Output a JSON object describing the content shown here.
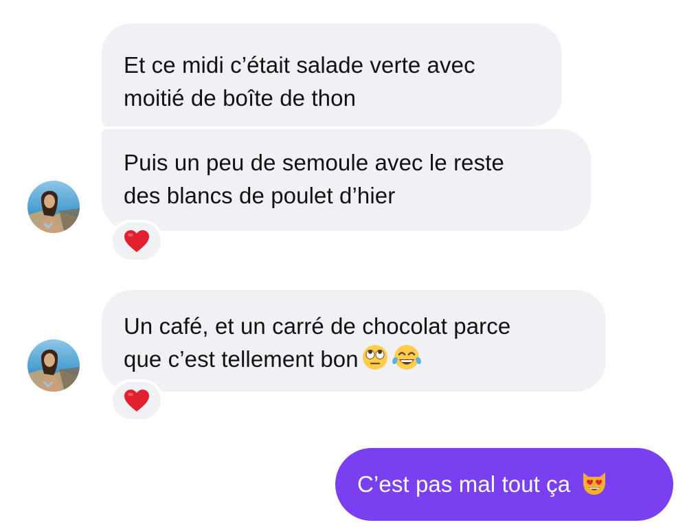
{
  "messages": [
    {
      "id": "b1",
      "sender": "other",
      "text": "Et ce midi c’était salade verte avec\nmoitié de boîte de thon"
    },
    {
      "id": "b2",
      "sender": "other",
      "text": "Puis un peu de semoule avec le reste\ndes blancs de poulet d’hier",
      "reaction": "red-heart"
    },
    {
      "id": "b3",
      "sender": "other",
      "text": "Un café, et un carré de chocolat parce\nque c’est tellement bon",
      "trailing_emojis": [
        "face-with-rolling-eyes",
        "face-with-tears-of-joy"
      ],
      "reaction": "red-heart"
    },
    {
      "id": "b4",
      "sender": "me",
      "text": "C’est pas mal tout ça",
      "trailing_emojis": [
        "smiling-cat-with-heart-eyes"
      ]
    }
  ],
  "colors": {
    "incoming_bubble": "#eff1f4",
    "outgoing_bubble": "#7a3ff0",
    "outgoing_text": "#ffffff",
    "heart": "#e0202e"
  },
  "icons": {
    "reaction": "red-heart-icon",
    "avatar": "contact-avatar"
  }
}
